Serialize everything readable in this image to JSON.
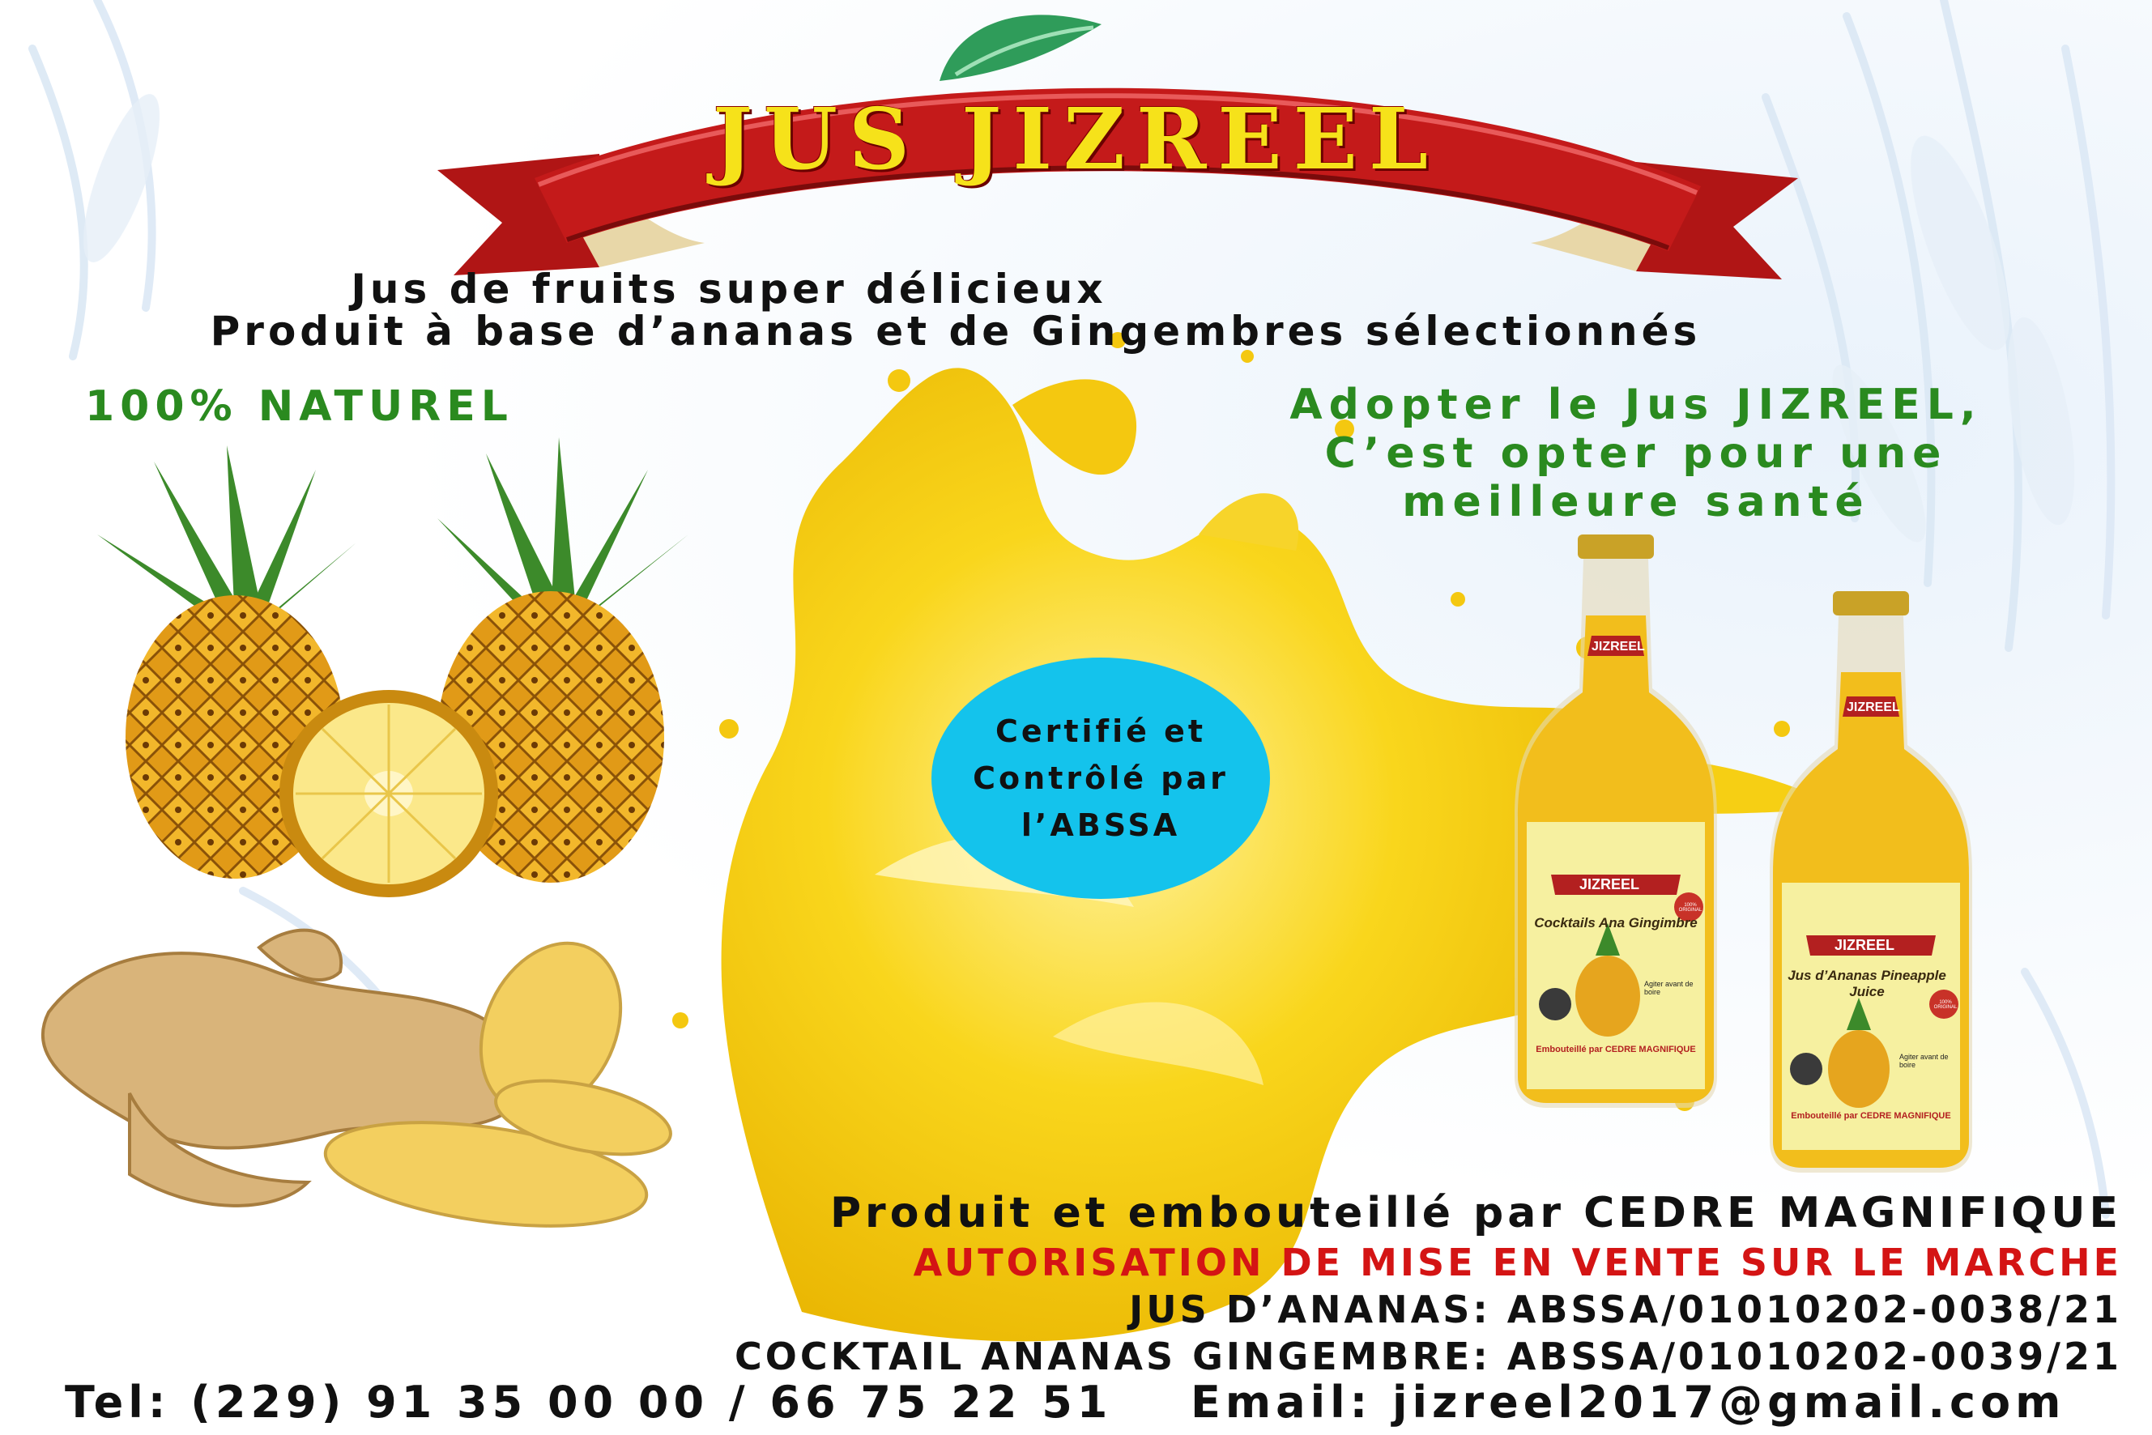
{
  "brand": {
    "title": "JUS JIZREEL",
    "tagline_1": "Jus de fruits super délicieux",
    "tagline_2": "Produit à base d’ananas et de Gingembres sélectionnés"
  },
  "left_claim": "100% NATUREL",
  "right_claim": {
    "line_1": "Adopter le Jus JIZREEL,",
    "line_2": "C’est opter pour une",
    "line_3": "meilleure santé"
  },
  "certification_badge": {
    "line_1": "Certifié et",
    "line_2": "Contrôlé par",
    "line_3": "l’ABSSA"
  },
  "bottles": [
    {
      "neck_label": "JIZREEL",
      "brand": "JIZREEL",
      "product": "Cocktails Ana Gingimbre",
      "note": "Agiter avant de boire",
      "bottler": "Embouteillé par CEDRE MAGNIFIQUE",
      "seal": "100% ORIGINAL"
    },
    {
      "neck_label": "JIZREEL",
      "brand": "JIZREEL",
      "product": "Jus d’Ananas Pineapple Juice",
      "note": "Agiter avant de boire",
      "bottler": "Embouteillé par CEDRE MAGNIFIQUE",
      "seal": "100% ORIGINAL"
    }
  ],
  "footer": {
    "produced_by": "Produit et embouteillé par CEDRE MAGNIFIQUE",
    "authorization": "AUTORISATION DE MISE EN VENTE SUR LE MARCHE",
    "jus_ananas": "JUS D’ANANAS: ABSSA/01010202-0038/21",
    "cocktail": "COCKTAIL ANANAS GINGEMBRE: ABSSA/01010202-0039/21",
    "tel": "Tel: (229) 91 35 00 00 / 66 75 22 51",
    "email": "Email: jizreel2017@gmail.com"
  },
  "colors": {
    "ribbon_red": "#c41a1a",
    "title_yellow": "#f6e21a",
    "claim_green": "#2a8a1f",
    "badge_cyan": "#14c3ec",
    "authorization_red": "#d41414",
    "juice_yellow": "#f7cf12"
  },
  "icons": [
    "palm-frond-decor",
    "juice-splash",
    "pineapple",
    "pineapple-slice",
    "ginger-root",
    "juice-bottle"
  ]
}
